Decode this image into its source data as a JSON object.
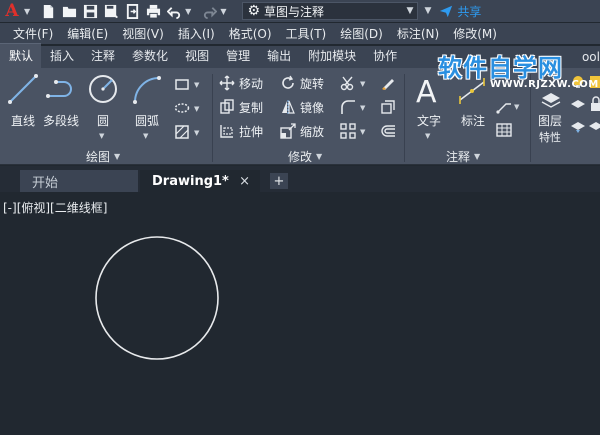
{
  "app": {
    "logo_letter": "A"
  },
  "workspace": {
    "selected": "草图与注释"
  },
  "share_label": "共享",
  "menu": [
    "文件(F)",
    "编辑(E)",
    "视图(V)",
    "插入(I)",
    "格式(O)",
    "工具(T)",
    "绘图(D)",
    "标注(N)",
    "修改(M)"
  ],
  "ribbon_tabs": [
    "默认",
    "插入",
    "注释",
    "参数化",
    "视图",
    "管理",
    "输出",
    "附加模块",
    "协作"
  ],
  "ribbon_tab_tail": "ool",
  "ribbon": {
    "draw": {
      "title": "绘图",
      "line": "直线",
      "polyline": "多段线",
      "circle": "圆",
      "arc": "圆弧"
    },
    "modify": {
      "title": "修改",
      "move": "移动",
      "rotate": "旋转",
      "copy": "复制",
      "mirror": "镜像",
      "stretch": "拉伸",
      "scale": "缩放"
    },
    "annotation": {
      "title": "注释",
      "text": "文字",
      "dimension": "标注"
    },
    "layers": {
      "label_line1": "图层",
      "label_line2": "特性"
    }
  },
  "watermark": {
    "main": "软件自学网",
    "url": "WWW.RJZXW.COM"
  },
  "doc_tabs": {
    "start": "开始",
    "drawing": "Drawing1*",
    "close": "×",
    "new": "+"
  },
  "viewport_label": "[-][俯视][二维线框]",
  "colors": {
    "canvas": "#212830",
    "ribbon": "#4a5363",
    "toolbar": "#3b4453",
    "accent_red": "#e0302b",
    "share_blue": "#2e9bf0",
    "watermark_blue": "#2a8fe0"
  }
}
